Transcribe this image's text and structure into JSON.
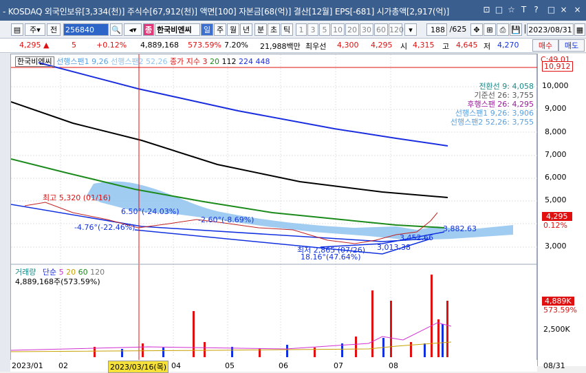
{
  "window": {
    "title": "- KOSDAQ 외국인보유[3,334(천)] 주식수[67,912(천)] 액면[100] 자본금[68(억)] 결산[12월] EPS[-681] 시가총액[2,917(억)]",
    "buttons": [
      "⊡",
      "□",
      "☆",
      "T",
      "?",
      "│",
      "□",
      "×"
    ]
  },
  "toolbar": {
    "period_select": "주",
    "prev_label": "전",
    "code": "256840",
    "jong_badge": "종",
    "stock_name": "한국비엔씨",
    "period_tabs": [
      "일",
      "주",
      "월",
      "년",
      "분",
      "초",
      "틱"
    ],
    "active_tab": "일",
    "interval_buttons": [
      "1",
      "3",
      "5",
      "10",
      "20",
      "30",
      "60",
      "120"
    ],
    "count": "188",
    "total": "/625",
    "date": "2023/08/31"
  },
  "quote": {
    "price": "4,295",
    "arrow": "▲",
    "change": "5",
    "change_pct": "+0.12%",
    "volume": "4,889,168",
    "volume_pct": "573.59%",
    "turnover": "7.20%",
    "amount": "21,988백만",
    "hoga_label": "최우선",
    "ask": "4,300",
    "bid": "4,295",
    "open_label": "시",
    "open": "4,315",
    "high_label": "고",
    "high": "4,645",
    "low_label": "저",
    "low": "4,270",
    "buy_button": "매수",
    "sell_button": "매도"
  },
  "price_pane": {
    "legend": {
      "name": "한국비엔씨",
      "span1": "선행스팬1 9,26",
      "span2": "선행스팬2 52,26",
      "ma": "종가 지수 3",
      "ma_vals": [
        "20",
        "112",
        "224",
        "448"
      ]
    },
    "ichimoku": {
      "conversion": "전환선 9: 4,058",
      "base": "기준선 26: 3,755",
      "lagging": "후행스팬 26: 4,295",
      "lead1": "선행스팬1 9,26: 3,906",
      "lead2": "선행스팬2 52,26: 3,755"
    },
    "annotations": {
      "high": "최고 5,320 (01/16)",
      "low": "최저 2,865 (07/26)",
      "pct1": "6.50°(-24.03%)",
      "pct2": "-4.76°(-22.46%)",
      "pct3": "-2.60°(-8.69%)",
      "pct4": "18.16°(47.64%)",
      "val1": "3,013.38",
      "val2": "3,452.66",
      "val3": "3,882.63"
    },
    "yaxis": {
      "labels": [
        "10,000",
        "9,000",
        "8,000",
        "7,000",
        "6,000",
        "5,000",
        "4,000",
        "3,000"
      ],
      "top_tag": "10,912",
      "top_label": "C:49.01",
      "price_tag": "4,295",
      "pct_tag": "0.12%"
    }
  },
  "volume_pane": {
    "legend": {
      "label": "거래량",
      "ma": "단순",
      "vals": [
        "5",
        "20",
        "60",
        "120"
      ]
    },
    "value_text": "4,889,168주(573.59%)",
    "yaxis": {
      "tag": "4,889K",
      "pct": "573.59%",
      "mid": "2,500K"
    }
  },
  "xaxis": {
    "labels": [
      "2023/01",
      "02",
      "04",
      "05",
      "06",
      "07",
      "08"
    ],
    "cursor_date": "2023/03/16(목)",
    "right_date": "08/31"
  },
  "colors": {
    "up": "#e01010",
    "down": "#1030e0",
    "cloud": "#8fc3f0",
    "ma20": "#1a8a1a",
    "ma112": "#000000",
    "ma224": "#1a2ee0"
  }
}
